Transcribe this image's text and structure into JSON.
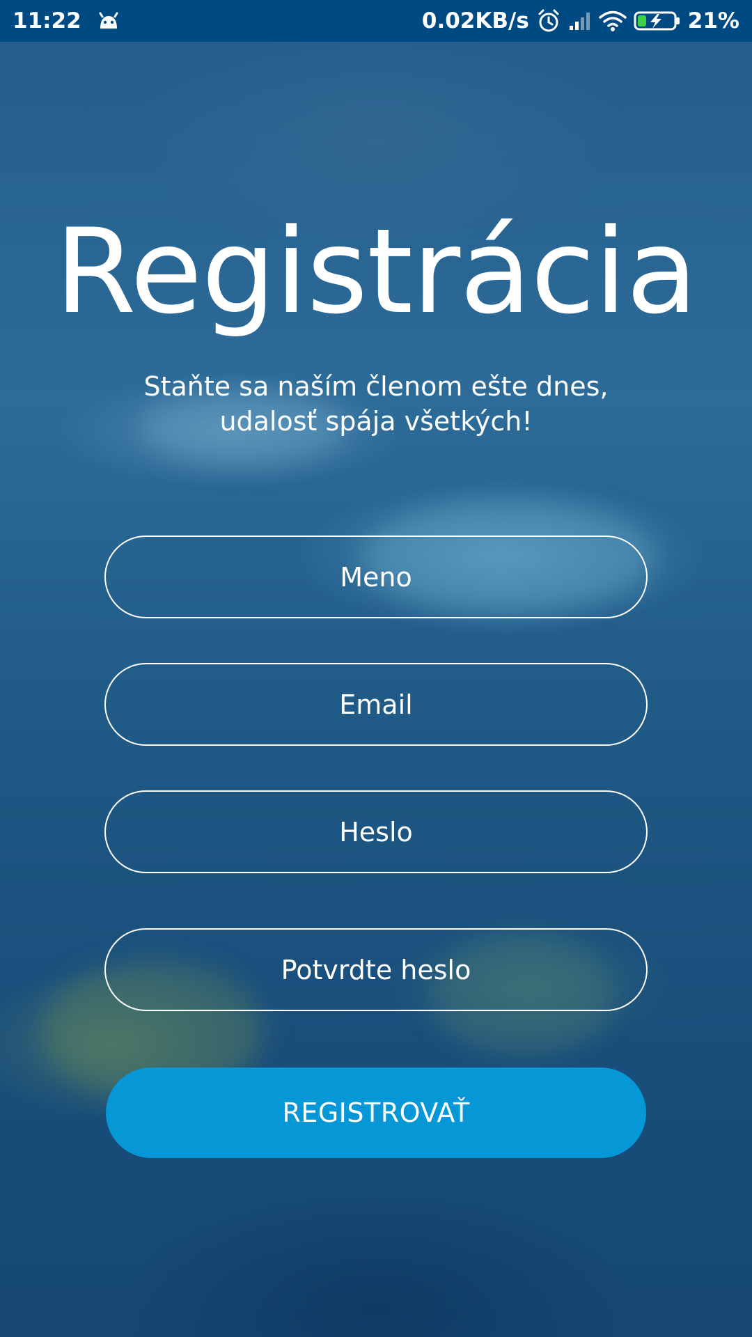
{
  "status_bar": {
    "time": "11:22",
    "network_speed": "0.02KB/s",
    "battery": "21%",
    "icons": [
      "android-icon",
      "alarm-icon",
      "signal-icon",
      "wifi-icon",
      "battery-charging-icon"
    ]
  },
  "registration": {
    "title": "Registrácia",
    "subtitle_line1": "Staňte sa naším členom ešte dnes,",
    "subtitle_line2": "udalosť spája všetkých!",
    "fields": {
      "name_placeholder": "Meno",
      "email_placeholder": "Email",
      "password_placeholder": "Heslo",
      "confirm_password_placeholder": "Potvrdte heslo"
    },
    "register_label": "REGISTROVAŤ"
  },
  "colors": {
    "status_bar": "#004a84",
    "background": "#1c5685",
    "button": "#0597d6",
    "text": "#ffffff"
  }
}
